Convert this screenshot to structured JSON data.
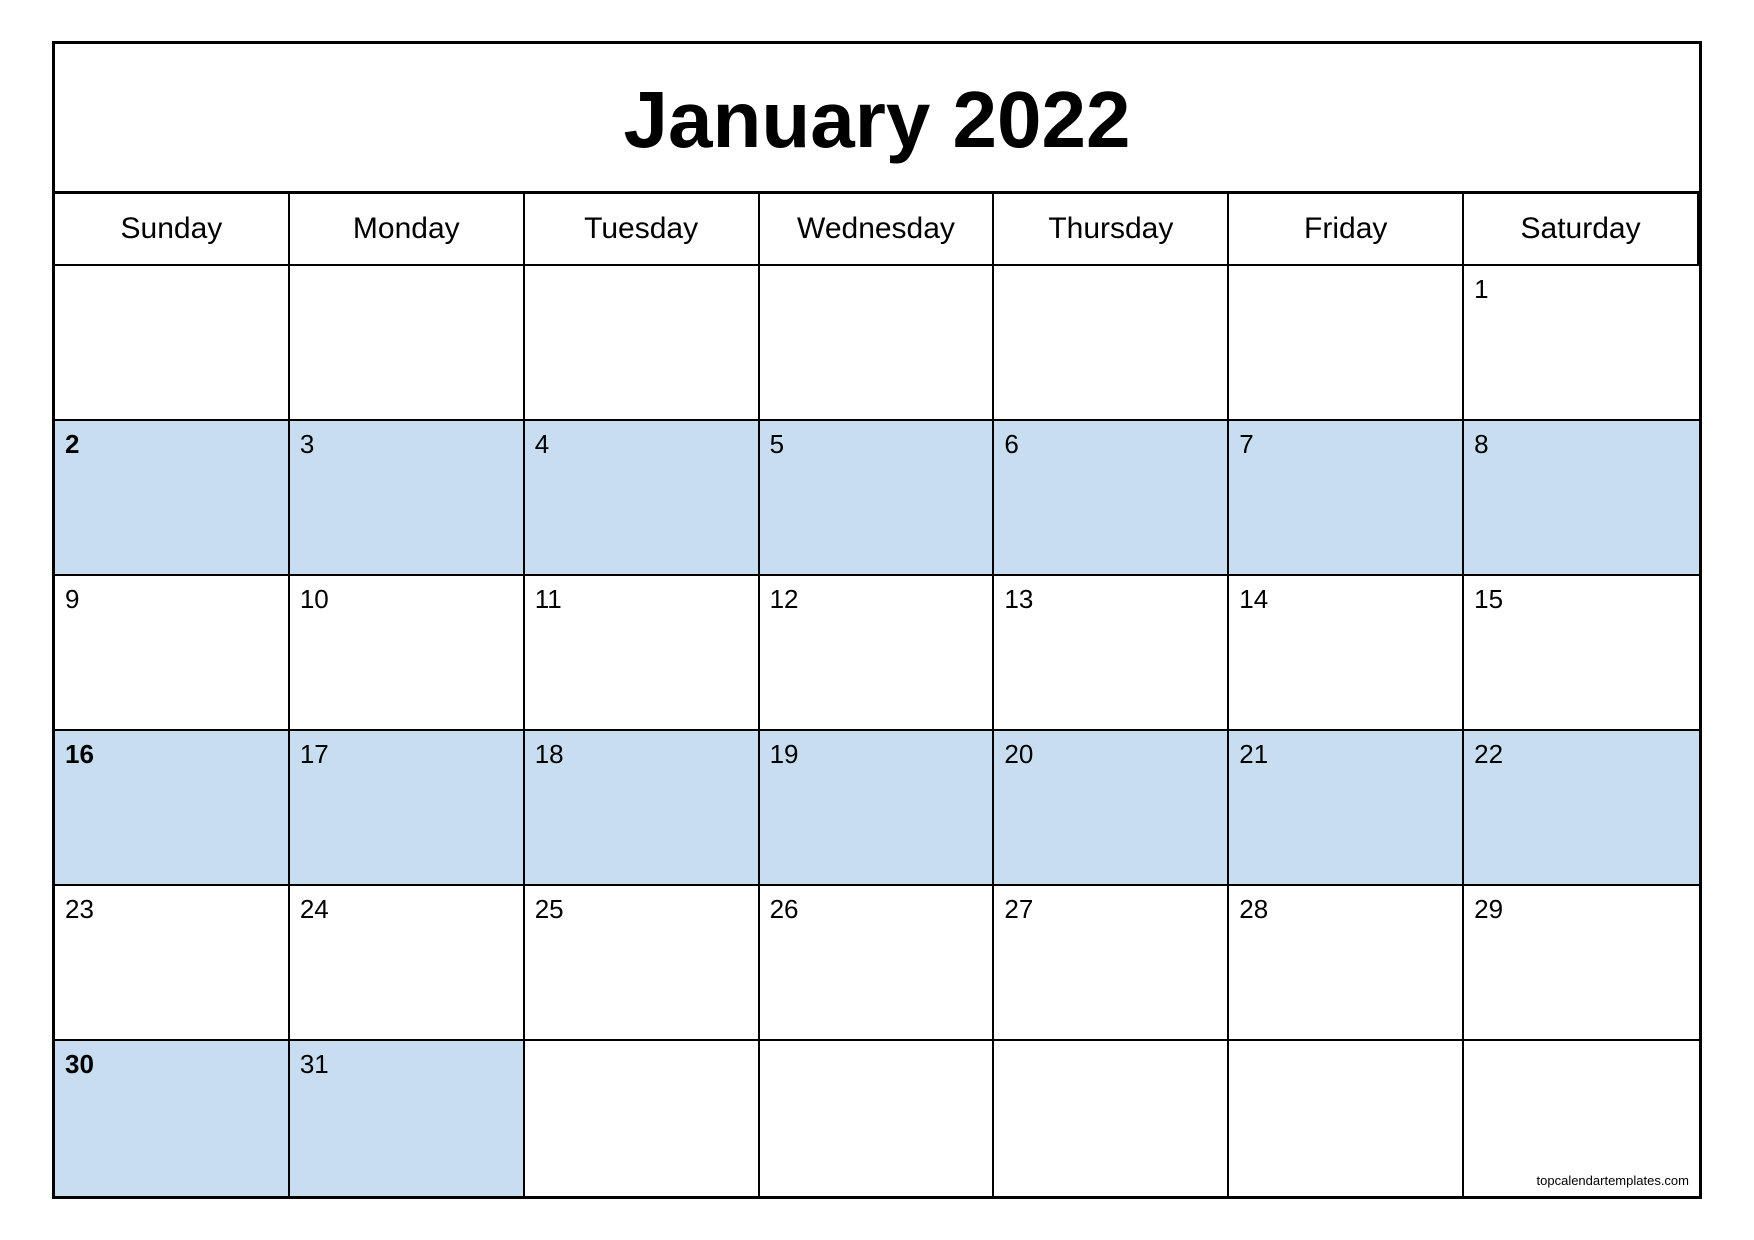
{
  "calendar": {
    "title": "January 2022",
    "month": "January",
    "year": "2022",
    "weekdays": [
      "Sunday",
      "Monday",
      "Tuesday",
      "Wednesday",
      "Thursday",
      "Friday",
      "Saturday"
    ],
    "watermark": "topcalendartemplates.com",
    "rows": [
      [
        {
          "day": "",
          "blue": false,
          "empty": true
        },
        {
          "day": "",
          "blue": false,
          "empty": true
        },
        {
          "day": "",
          "blue": false,
          "empty": true
        },
        {
          "day": "",
          "blue": false,
          "empty": true
        },
        {
          "day": "",
          "blue": false,
          "empty": true
        },
        {
          "day": "",
          "blue": false,
          "empty": true
        },
        {
          "day": "1",
          "blue": false,
          "empty": false
        }
      ],
      [
        {
          "day": "2",
          "blue": true,
          "bold": true
        },
        {
          "day": "3",
          "blue": true
        },
        {
          "day": "4",
          "blue": true
        },
        {
          "day": "5",
          "blue": true
        },
        {
          "day": "6",
          "blue": true
        },
        {
          "day": "7",
          "blue": true
        },
        {
          "day": "8",
          "blue": true
        }
      ],
      [
        {
          "day": "9",
          "blue": false
        },
        {
          "day": "10",
          "blue": false
        },
        {
          "day": "11",
          "blue": false
        },
        {
          "day": "12",
          "blue": false
        },
        {
          "day": "13",
          "blue": false
        },
        {
          "day": "14",
          "blue": false
        },
        {
          "day": "15",
          "blue": false
        }
      ],
      [
        {
          "day": "16",
          "blue": true,
          "bold": true
        },
        {
          "day": "17",
          "blue": true
        },
        {
          "day": "18",
          "blue": true
        },
        {
          "day": "19",
          "blue": true
        },
        {
          "day": "20",
          "blue": true
        },
        {
          "day": "21",
          "blue": true
        },
        {
          "day": "22",
          "blue": true
        }
      ],
      [
        {
          "day": "23",
          "blue": false
        },
        {
          "day": "24",
          "blue": false
        },
        {
          "day": "25",
          "blue": false
        },
        {
          "day": "26",
          "blue": false
        },
        {
          "day": "27",
          "blue": false
        },
        {
          "day": "28",
          "blue": false
        },
        {
          "day": "29",
          "blue": false
        }
      ],
      [
        {
          "day": "30",
          "blue": true,
          "bold": true
        },
        {
          "day": "31",
          "blue": true
        },
        {
          "day": "",
          "blue": false,
          "empty": true
        },
        {
          "day": "",
          "blue": false,
          "empty": true
        },
        {
          "day": "",
          "blue": false,
          "empty": true
        },
        {
          "day": "",
          "blue": false,
          "empty": true
        },
        {
          "day": "",
          "blue": false,
          "empty": true,
          "watermark": true
        }
      ]
    ]
  }
}
